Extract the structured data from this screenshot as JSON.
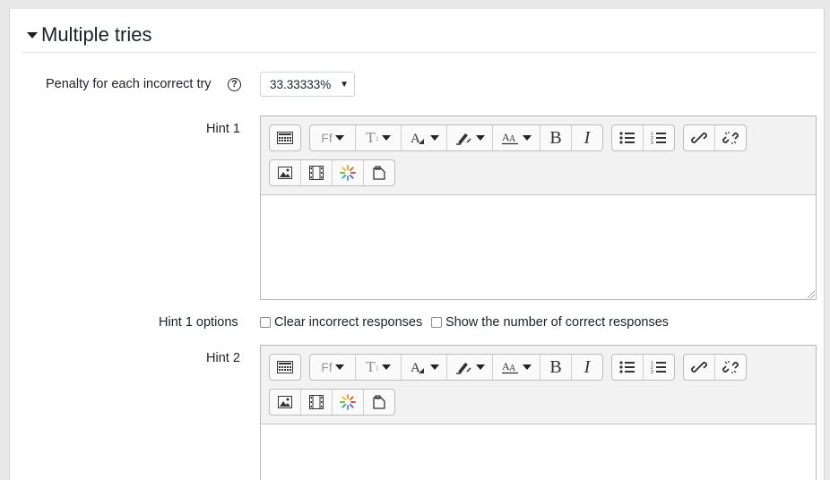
{
  "section": {
    "title": "Multiple tries"
  },
  "penalty": {
    "label": "Penalty for each incorrect try",
    "help_glyph": "?",
    "value": "33.33333%"
  },
  "hints": [
    {
      "label": "Hint 1",
      "options_label": "Hint 1 options",
      "opt_clear": "Clear incorrect responses",
      "opt_show": "Show the number of correct responses"
    },
    {
      "label": "Hint 2"
    }
  ],
  "toolbar": {
    "font_family_glyph": "Ff",
    "font_size_glyph": "T",
    "bold_glyph": "B",
    "italic_glyph": "I",
    "buttons_row1": [
      "toggle-toolbar-icon",
      "font-family-icon",
      "font-size-icon",
      "font-color-icon",
      "highlight-icon",
      "font-style-icon",
      "bold-icon",
      "italic-icon",
      "unordered-list-icon",
      "ordered-list-icon",
      "link-icon",
      "unlink-icon"
    ],
    "buttons_row2": [
      "image-icon",
      "media-icon",
      "recordrtc-icon",
      "paste-icon"
    ]
  },
  "colors": {
    "panel_bg": "#ffffff",
    "editor_bg": "#f2f2f2",
    "border": "#b8b8b8"
  }
}
